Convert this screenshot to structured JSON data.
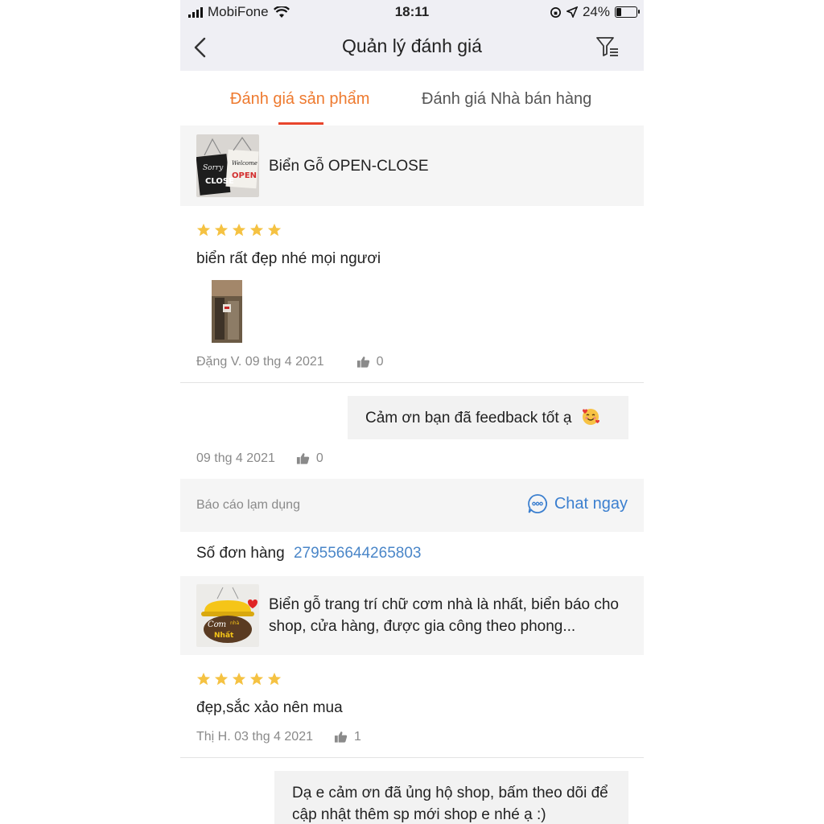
{
  "status_bar": {
    "carrier": "MobiFone",
    "time": "18:11",
    "battery": "24%"
  },
  "header": {
    "title": "Quản lý đánh giá"
  },
  "tabs": [
    {
      "label": "Đánh giá sản phẩm",
      "active": true
    },
    {
      "label": "Đánh giá Nhà bán hàng",
      "active": false
    }
  ],
  "reviews": [
    {
      "product_name": "Biển Gỗ OPEN-CLOSE",
      "rating": 5,
      "text": "biển rất đẹp nhé mọi ngươi",
      "author_date": "Đặng V. 09 thg 4 2021",
      "likes": "0",
      "reply": {
        "text": "Cảm ơn bạn đã feedback tốt ạ",
        "date": "09 thg 4 2021",
        "likes": "0"
      },
      "report_label": "Báo cáo lạm dụng",
      "chat_label": "Chat ngay"
    },
    {
      "order_label": "Số đơn hàng",
      "order_id": "279556644265803",
      "product_name": "Biển gỗ trang trí chữ cơm nhà là nhất, biển báo cho shop, cửa hàng, được gia công theo phong...",
      "rating": 5,
      "text": "đẹp,sắc xảo nên mua",
      "author_date": "Thị H. 03 thg 4 2021",
      "likes": "1",
      "reply": {
        "text": "Dạ e cảm ơn đã ủng hộ shop, bấm theo dõi để cập nhật thêm sp mới shop e nhé ạ :)"
      }
    }
  ],
  "colors": {
    "accent_orange": "#ee7a2f",
    "tab_underline": "#e8452c",
    "star": "#f5c242",
    "link_blue": "#3b7fcf"
  },
  "icons": [
    "back-chevron-icon",
    "filter-icon",
    "star-icon",
    "thumbs-up-icon",
    "chat-bubble-icon",
    "wifi-icon",
    "location-arrow-icon",
    "battery-icon"
  ]
}
